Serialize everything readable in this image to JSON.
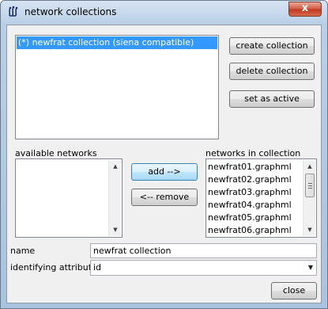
{
  "window": {
    "title": "network collections",
    "close_label": "x"
  },
  "collections": {
    "items": [
      "(*) newfrat collection (siena compatible)"
    ],
    "selected_index": 0
  },
  "buttons": {
    "create": "create collection",
    "delete": "delete collection",
    "set_active": "set as active",
    "add": "add -->",
    "remove": "<-- remove",
    "close": "close"
  },
  "available_networks": {
    "label": "available networks",
    "items": []
  },
  "networks_in_collection": {
    "label": "networks in collection",
    "items": [
      "newfrat01.graphml",
      "newfrat02.graphml",
      "newfrat03.graphml",
      "newfrat04.graphml",
      "newfrat05.graphml",
      "newfrat06.graphml"
    ]
  },
  "name_field": {
    "label": "name",
    "value": "newfrat collection"
  },
  "identifying_attribute": {
    "label": "identifying attribute",
    "value": "id"
  },
  "icons": {
    "app": "network-icon",
    "close": "close-icon",
    "scroll_up": "arrow-up-icon",
    "scroll_down": "arrow-down-icon",
    "dropdown": "chevron-down-icon"
  }
}
